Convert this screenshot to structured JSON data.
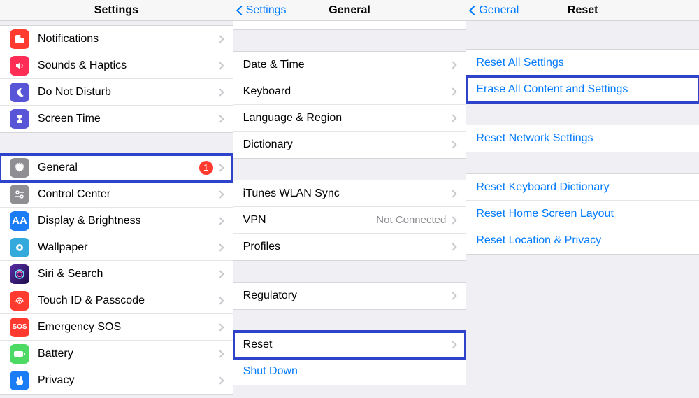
{
  "panel1": {
    "title": "Settings",
    "items": [
      {
        "label": "Notifications"
      },
      {
        "label": "Sounds & Haptics"
      },
      {
        "label": "Do Not Disturb"
      },
      {
        "label": "Screen Time"
      }
    ],
    "general": {
      "label": "General",
      "badge": "1"
    },
    "items2": [
      {
        "label": "Control Center"
      },
      {
        "label": "Display & Brightness"
      },
      {
        "label": "Wallpaper"
      },
      {
        "label": "Siri & Search"
      },
      {
        "label": "Touch ID & Passcode"
      },
      {
        "label": "Emergency SOS"
      },
      {
        "label": "Battery"
      },
      {
        "label": "Privacy"
      }
    ]
  },
  "panel2": {
    "back": "Settings",
    "title": "General",
    "groupA": [
      {
        "label": "Date & Time"
      },
      {
        "label": "Keyboard"
      },
      {
        "label": "Language & Region"
      },
      {
        "label": "Dictionary"
      }
    ],
    "groupB": [
      {
        "label": "iTunes WLAN Sync"
      },
      {
        "label": "VPN",
        "detail": "Not Connected"
      },
      {
        "label": "Profiles"
      }
    ],
    "regulatory": "Regulatory",
    "reset": "Reset",
    "shutdown": "Shut Down"
  },
  "panel3": {
    "back": "General",
    "title": "Reset",
    "groupA": [
      {
        "label": "Reset All Settings"
      },
      {
        "label": "Erase All Content and Settings"
      }
    ],
    "groupB": [
      {
        "label": "Reset Network Settings"
      }
    ],
    "groupC": [
      {
        "label": "Reset Keyboard Dictionary"
      },
      {
        "label": "Reset Home Screen Layout"
      },
      {
        "label": "Reset Location & Privacy"
      }
    ]
  }
}
